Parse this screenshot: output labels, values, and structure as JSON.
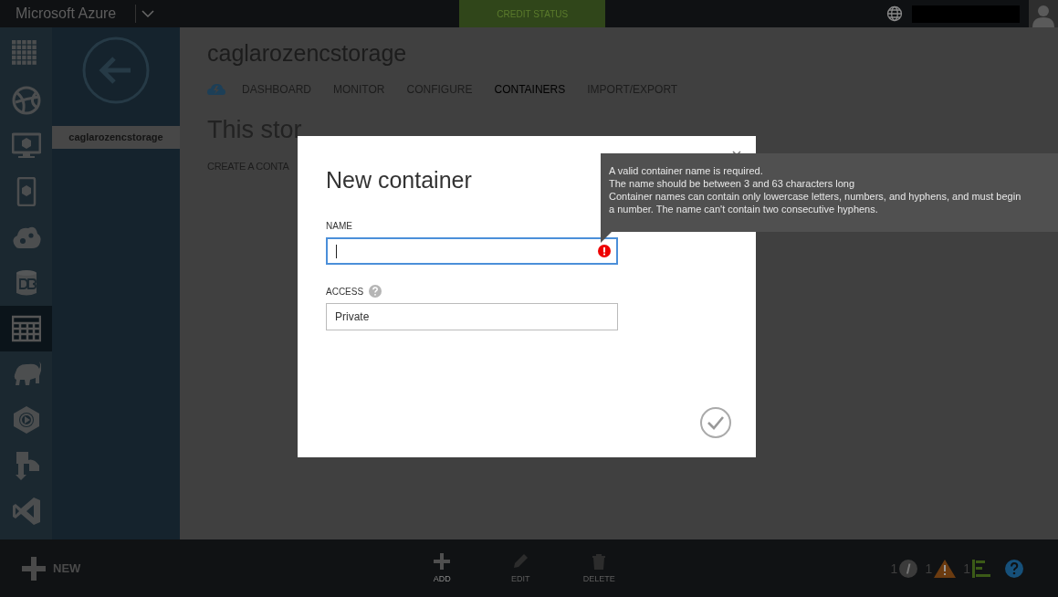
{
  "topbar": {
    "brand": "Microsoft Azure",
    "credit_status": "CREDIT STATUS"
  },
  "rail": {
    "items": [
      {
        "selected": false
      },
      {
        "selected": false
      },
      {
        "selected": false
      },
      {
        "selected": false
      },
      {
        "selected": false
      },
      {
        "selected": false
      },
      {
        "selected": true
      },
      {
        "selected": false
      },
      {
        "selected": false
      },
      {
        "selected": false
      },
      {
        "selected": false
      }
    ]
  },
  "subnav": {
    "items": [
      {
        "label": "caglarozencstorage",
        "selected": true
      }
    ]
  },
  "page": {
    "title": "caglarozencstorage",
    "tabs": [
      {
        "label": "DASHBOARD",
        "selected": false
      },
      {
        "label": "MONITOR",
        "selected": false
      },
      {
        "label": "CONFIGURE",
        "selected": false
      },
      {
        "label": "CONTAINERS",
        "selected": true
      },
      {
        "label": "IMPORT/EXPORT",
        "selected": false
      }
    ],
    "heading": "This stor",
    "action": "CREATE A CONTA"
  },
  "dialog": {
    "title": "New container",
    "fields": [
      {
        "kind": "text",
        "label": "NAME",
        "invalid": true,
        "help": false
      },
      {
        "kind": "select",
        "label": "ACCESS",
        "value": "Private",
        "invalid": false,
        "help": true
      }
    ]
  },
  "tooltip": {
    "lines": [
      "A valid container name is required.",
      "The name should be between 3 and 63 characters long",
      "Container names can contain only lowercase letters, numbers, and hyphens, and must begin",
      "a number. The name can't contain two consecutive hyphens."
    ]
  },
  "bottombar": {
    "new": "NEW",
    "actions": [
      {
        "label": "ADD",
        "disabled": false
      },
      {
        "label": "EDIT",
        "disabled": true
      },
      {
        "label": "DELETE",
        "disabled": true
      }
    ],
    "notifications": [
      {
        "kind": "info",
        "count": "1"
      },
      {
        "kind": "warning",
        "count": "1"
      },
      {
        "kind": "progress",
        "count": "1"
      }
    ]
  }
}
